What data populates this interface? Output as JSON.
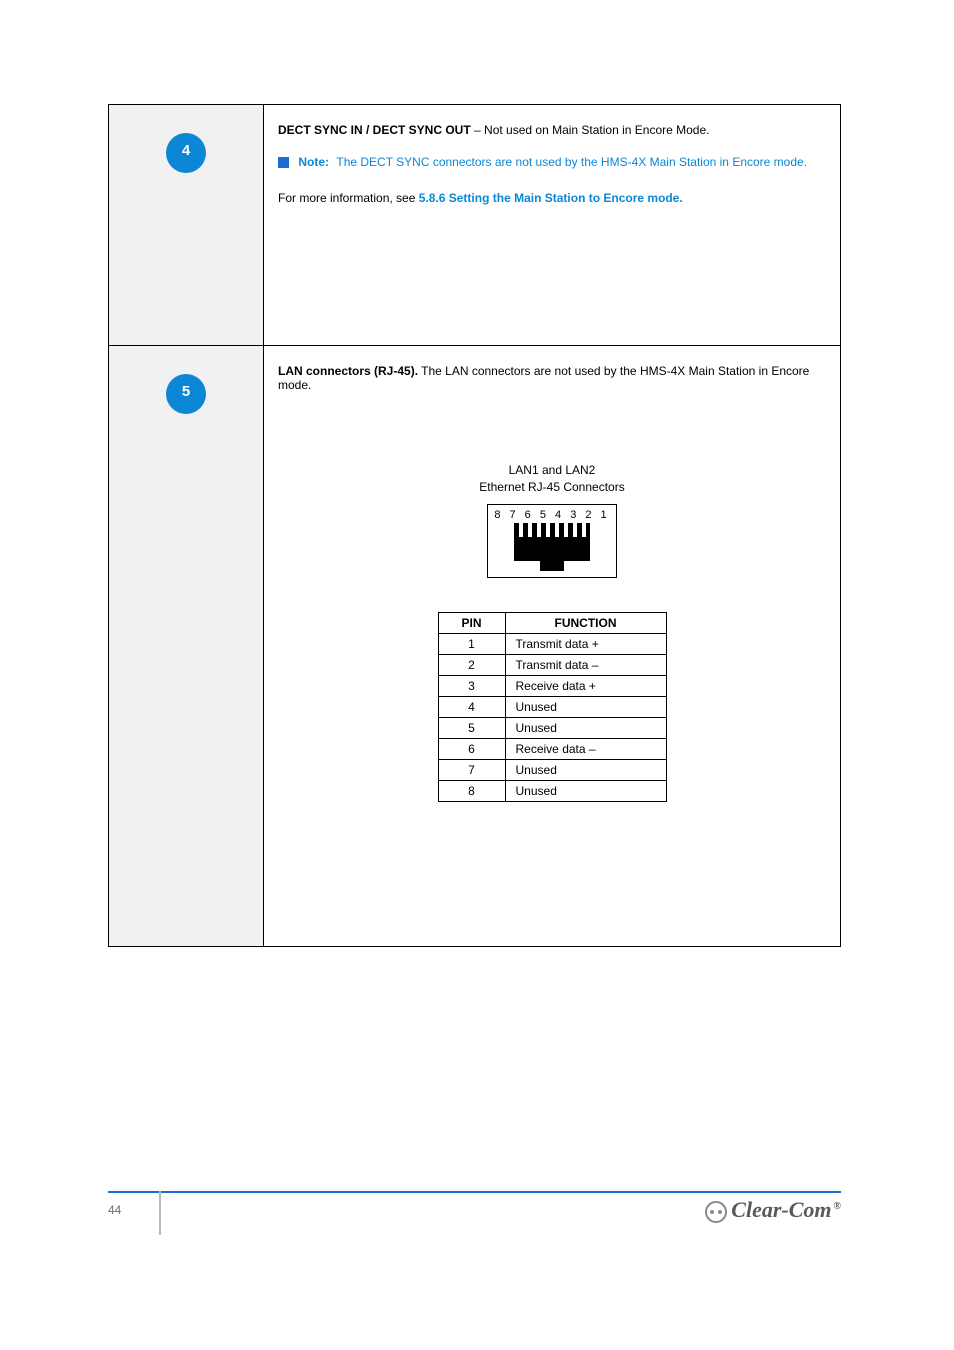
{
  "row1": {
    "num": "4",
    "lead": "DECT SYNC IN / DECT SYNC OUT",
    "tail": " – Not used on Main Station in Encore Mode."
  },
  "note_icon": "■",
  "note_label": "Note:",
  "note_text": "The DECT SYNC connectors are not used by the HMS-4X Main Station in Encore mode.",
  "xref_pre": "For more information, see ",
  "xref_link": "5.8.6 Setting the Main Station to Encore mode.",
  "row2": {
    "num": "5",
    "bold": "LAN connectors (RJ-45).",
    "text": " The LAN connectors are not used by the HMS-4X Main Station in Encore mode."
  },
  "fig": {
    "l1": "LAN1 and LAN2",
    "l2": "Ethernet RJ-45 Connectors",
    "pins": "8 7 6 5 4 3 2 1"
  },
  "pt": {
    "h1": "PIN",
    "h2": "FUNCTION",
    "rows": [
      {
        "p": "1",
        "f": "Transmit data +"
      },
      {
        "p": "2",
        "f": "Transmit data –"
      },
      {
        "p": "3",
        "f": "Receive data +"
      },
      {
        "p": "4",
        "f": "Unused"
      },
      {
        "p": "5",
        "f": "Unused"
      },
      {
        "p": "6",
        "f": "Receive data –"
      },
      {
        "p": "7",
        "f": "Unused"
      },
      {
        "p": "8",
        "f": "Unused"
      }
    ]
  },
  "pageno": "44",
  "brand": "Clear-Com"
}
